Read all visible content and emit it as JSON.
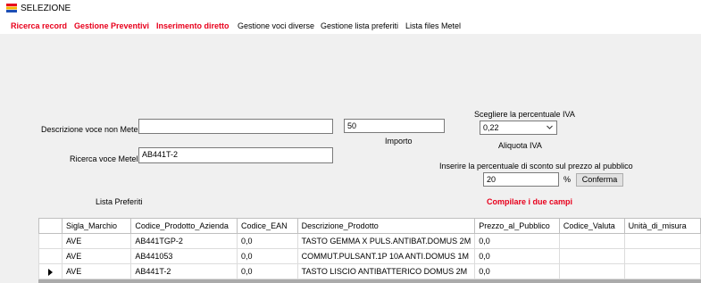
{
  "window": {
    "title": "SELEZIONE"
  },
  "menu": {
    "items": [
      {
        "label": "Ricerca record",
        "color": "#e8001c"
      },
      {
        "label": "Gestione Preventivi",
        "color": "#e8001c"
      },
      {
        "label": "Inserimento diretto",
        "color": "#e8001c"
      },
      {
        "label": "Gestione voci diverse",
        "color": "#000000"
      },
      {
        "label": "Gestione lista preferiti",
        "color": "#000000"
      },
      {
        "label": "Lista files Metel",
        "color": "#000000"
      }
    ]
  },
  "form": {
    "descrizione_label": "Descrizione voce non Metel",
    "descrizione_value": "",
    "ricerca_label": "Ricerca voce Metel",
    "ricerca_value": "AB441T-2",
    "importo_value": "50",
    "importo_label": "Importo",
    "iva_prompt": "Scegliere la percentuale IVA",
    "iva_selected": "0,22",
    "iva_label": "Aliquota IVA",
    "sconto_prompt": "Inserire la percentuale di sconto sul prezzo al pubblico",
    "sconto_value": "20",
    "percent_sign": "%",
    "conferma_label": "Conferma",
    "warning": "Compilare i due campi",
    "lista_preferiti_label": "Lista Preferiti"
  },
  "grid": {
    "columns": [
      "Sigla_Marchio",
      "Codice_Prodotto_Azienda",
      "Codice_EAN",
      "Descrizione_Prodotto",
      "Prezzo_al_Pubblico",
      "Codice_Valuta",
      "Unità_di_misura"
    ],
    "rows": [
      [
        "AVE",
        "AB441TGP-2",
        "0,0",
        "TASTO GEMMA X PULS.ANTIBAT.DOMUS 2M",
        "0,0",
        "",
        ""
      ],
      [
        "AVE",
        "AB441053",
        "0,0",
        "COMMUT.PULSANT.1P 10A ANTI.DOMUS 1M",
        "0,0",
        "",
        ""
      ],
      [
        "AVE",
        "AB441T-2",
        "0,0",
        "TASTO LISCIO ANTIBATTERICO DOMUS 2M",
        "0,0",
        "",
        ""
      ]
    ],
    "current_row": 2
  },
  "colors": {
    "accent_red": "#e8001c",
    "background": "#f0f0f0"
  }
}
